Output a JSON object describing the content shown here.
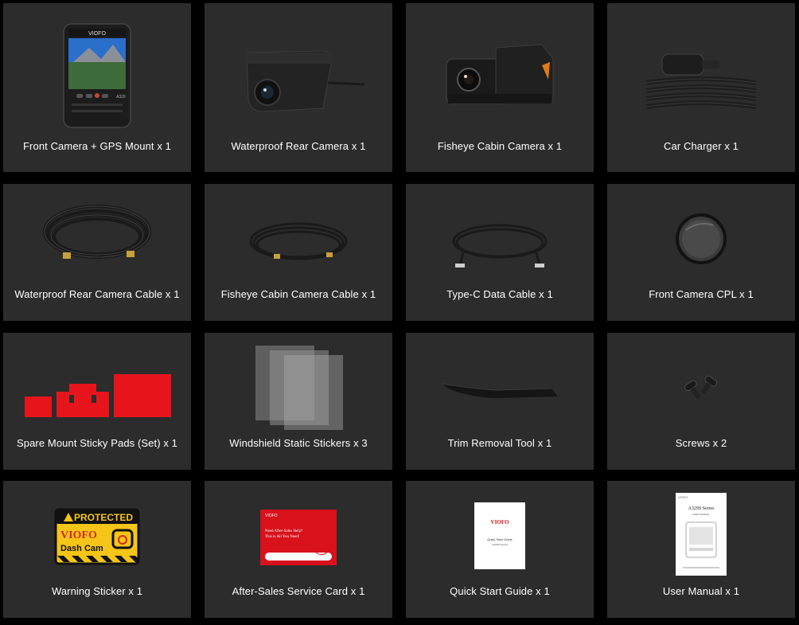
{
  "items": [
    {
      "label": "Front Camera + GPS Mount x 1",
      "icon": "front-camera-icon"
    },
    {
      "label": "Waterproof Rear Camera x 1",
      "icon": "rear-camera-icon"
    },
    {
      "label": "Fisheye Cabin Camera x 1",
      "icon": "cabin-camera-icon"
    },
    {
      "label": "Car Charger x 1",
      "icon": "car-charger-icon"
    },
    {
      "label": "Waterproof Rear Camera Cable x 1",
      "icon": "rear-cable-icon"
    },
    {
      "label": "Fisheye Cabin Camera Cable x 1",
      "icon": "cabin-cable-icon"
    },
    {
      "label": "Type-C Data Cable x 1",
      "icon": "type-c-cable-icon"
    },
    {
      "label": "Front Camera CPL x 1",
      "icon": "cpl-filter-icon"
    },
    {
      "label": "Spare Mount Sticky Pads (Set) x 1",
      "icon": "sticky-pads-icon"
    },
    {
      "label": "Windshield Static Stickers x 3",
      "icon": "static-stickers-icon"
    },
    {
      "label": "Trim Removal Tool x 1",
      "icon": "trim-tool-icon"
    },
    {
      "label": "Screws x 2",
      "icon": "screws-icon"
    },
    {
      "label": "Warning Sticker x 1",
      "icon": "warning-sticker-icon"
    },
    {
      "label": "After-Sales Service Card x 1",
      "icon": "service-card-icon"
    },
    {
      "label": "Quick Start Guide x 1",
      "icon": "quick-start-guide-icon"
    },
    {
      "label": "User Manual x 1",
      "icon": "user-manual-icon"
    }
  ],
  "product_text": {
    "brand": "VIOFO",
    "model": "A329",
    "sticker_line1": "PROTECTED",
    "sticker_line2": "VIOFO",
    "sticker_line3": "Dash Cam",
    "card_line1": "Need After-Sales Help?",
    "card_line2": "This is All You Need!",
    "guide_title": "Quick Start Guide",
    "guide_sub": "(A329S Series)",
    "manual_title": "A329S Series",
    "manual_sub": "USER MANUAL"
  },
  "colors": {
    "background": "#000000",
    "tile": "#2c2c2c",
    "label": "#ffffff",
    "pad_red": "#e8141c",
    "sticker_yellow": "#f5c518"
  }
}
